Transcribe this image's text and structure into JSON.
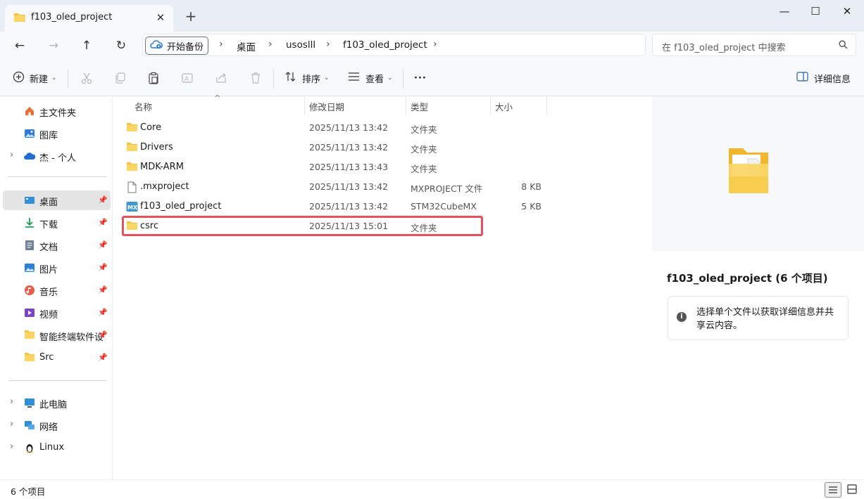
{
  "tab": {
    "title": "f103_oled_project",
    "close": "✕",
    "new_tab": "+"
  },
  "window_controls": {
    "minimize": "—",
    "maximize": "☐",
    "close": "✕"
  },
  "nav": {
    "back": "←",
    "forward": "→",
    "up": "↑",
    "refresh": "↻"
  },
  "address": {
    "backup_label": "开始备份",
    "crumbs": [
      "桌面",
      "usoslll",
      "f103_oled_project"
    ],
    "separator": "›"
  },
  "search": {
    "placeholder": "在 f103_oled_project 中搜索"
  },
  "toolbar": {
    "new_label": "新建",
    "sort_label": "排序",
    "view_label": "查看",
    "more_label": "···",
    "details_label": "详细信息"
  },
  "sidebar": {
    "top": [
      {
        "label": "主文件夹",
        "icon": "home-icon"
      },
      {
        "label": "图库",
        "icon": "gallery-icon"
      },
      {
        "label": "杰 - 个人",
        "icon": "onedrive-icon",
        "expandable": true
      }
    ],
    "pinned": [
      {
        "label": "桌面",
        "icon": "desktop-icon",
        "selected": true
      },
      {
        "label": "下载",
        "icon": "download-icon"
      },
      {
        "label": "文档",
        "icon": "document-icon"
      },
      {
        "label": "图片",
        "icon": "pictures-icon"
      },
      {
        "label": "音乐",
        "icon": "music-icon"
      },
      {
        "label": "视频",
        "icon": "video-icon"
      },
      {
        "label": "智能终端软件设",
        "icon": "folder-icon"
      },
      {
        "label": "Src",
        "icon": "folder-icon"
      }
    ],
    "bottom": [
      {
        "label": "此电脑",
        "icon": "this-pc-icon"
      },
      {
        "label": "网络",
        "icon": "network-icon"
      },
      {
        "label": "Linux",
        "icon": "linux-icon"
      }
    ],
    "pin_glyph": "📌",
    "chevron": "›"
  },
  "columns": {
    "name": "名称",
    "modified": "修改日期",
    "type": "类型",
    "size": "大小",
    "sort_arrow": "^"
  },
  "files": [
    {
      "name": "Core",
      "modified": "2025/11/13 13:42",
      "type": "文件夹",
      "size": "",
      "icon": "folder-icon"
    },
    {
      "name": "Drivers",
      "modified": "2025/11/13 13:42",
      "type": "文件夹",
      "size": "",
      "icon": "folder-icon"
    },
    {
      "name": "MDK-ARM",
      "modified": "2025/11/13 13:43",
      "type": "文件夹",
      "size": "",
      "icon": "folder-icon"
    },
    {
      "name": ".mxproject",
      "modified": "2025/11/13 13:42",
      "type": "MXPROJECT 文件",
      "size": "8 KB",
      "icon": "file-icon"
    },
    {
      "name": "f103_oled_project",
      "modified": "2025/11/13 13:42",
      "type": "STM32CubeMX",
      "size": "5 KB",
      "icon": "cubemx-icon"
    },
    {
      "name": "csrc",
      "modified": "2025/11/13 15:01",
      "type": "文件夹",
      "size": "",
      "icon": "folder-icon",
      "highlighted": true
    }
  ],
  "details": {
    "title": "f103_oled_project (6 个项目)",
    "info_text": "选择单个文件以获取详细信息并共享云内容。"
  },
  "status": {
    "count": "6 个项目"
  },
  "colors": {
    "highlight": "#e8505e",
    "folder": "#f5c342",
    "accent": "#2b7bd6"
  }
}
